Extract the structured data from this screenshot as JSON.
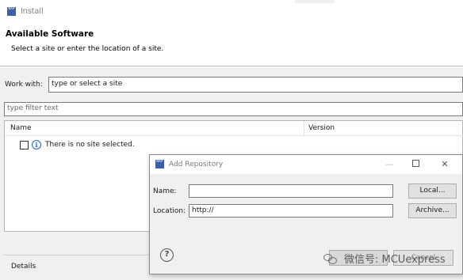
{
  "window": {
    "title": "Install",
    "icon_text": "NXP"
  },
  "banner": {
    "heading": "Available Software",
    "description": "Select a site or enter the location of a site."
  },
  "work_with": {
    "label": "Work with:",
    "value": "type or select a site"
  },
  "filter": {
    "placeholder": "type filter text"
  },
  "tree": {
    "columns": [
      "Name",
      "Version"
    ],
    "empty_message": "There is no site selected."
  },
  "details": {
    "label": "Details"
  },
  "dialog": {
    "title": "Add Repository",
    "icon_text": "NXP",
    "name_label": "Name:",
    "name_value": "",
    "local_button": "Local...",
    "location_label": "Location:",
    "location_value": "http://",
    "archive_button": "Archive...",
    "help_glyph": "?",
    "close_glyph": "✕",
    "min_glyph": "—",
    "cancel_label": "Cancel"
  },
  "watermark": {
    "text": "微信号: MCUexpress"
  }
}
